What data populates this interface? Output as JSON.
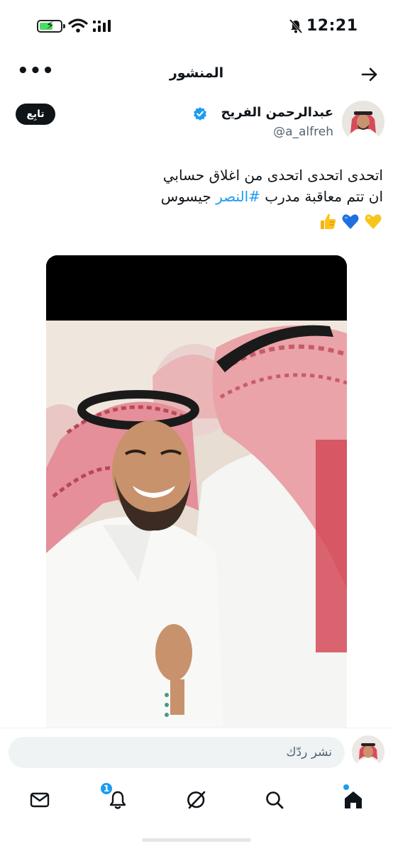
{
  "status_bar": {
    "time": "12:21",
    "icons": [
      "battery-charging-icon",
      "wifi-icon",
      "signal-icon",
      "mute-icon"
    ]
  },
  "header": {
    "title": "المنشور",
    "more_icon": "more-icon",
    "back_icon": "arrow-right-icon"
  },
  "author": {
    "name": "عبدالرحمن الفريح",
    "handle": "@a_alfreh",
    "follow_label": "تابِع",
    "verified_icon": "verified-badge-icon"
  },
  "tweet": {
    "line1": "اتحدى اتحدى اتحدى من اغلاق حسابي",
    "line2_prefix": "ان تتم معاقبة مدرب ",
    "hashtag": "#النصر",
    "line2_suffix": " جيسوس",
    "emojis": [
      "👍",
      "💙",
      "💛"
    ]
  },
  "reply": {
    "placeholder": "نشر ردّك"
  },
  "bottom_nav": {
    "items": [
      "mail-icon",
      "bell-icon",
      "grok-icon",
      "search-icon",
      "home-icon"
    ],
    "notification_count": "1"
  },
  "colors": {
    "accent": "#1d9bf0",
    "text": "#0f1419",
    "muted": "#536471"
  }
}
